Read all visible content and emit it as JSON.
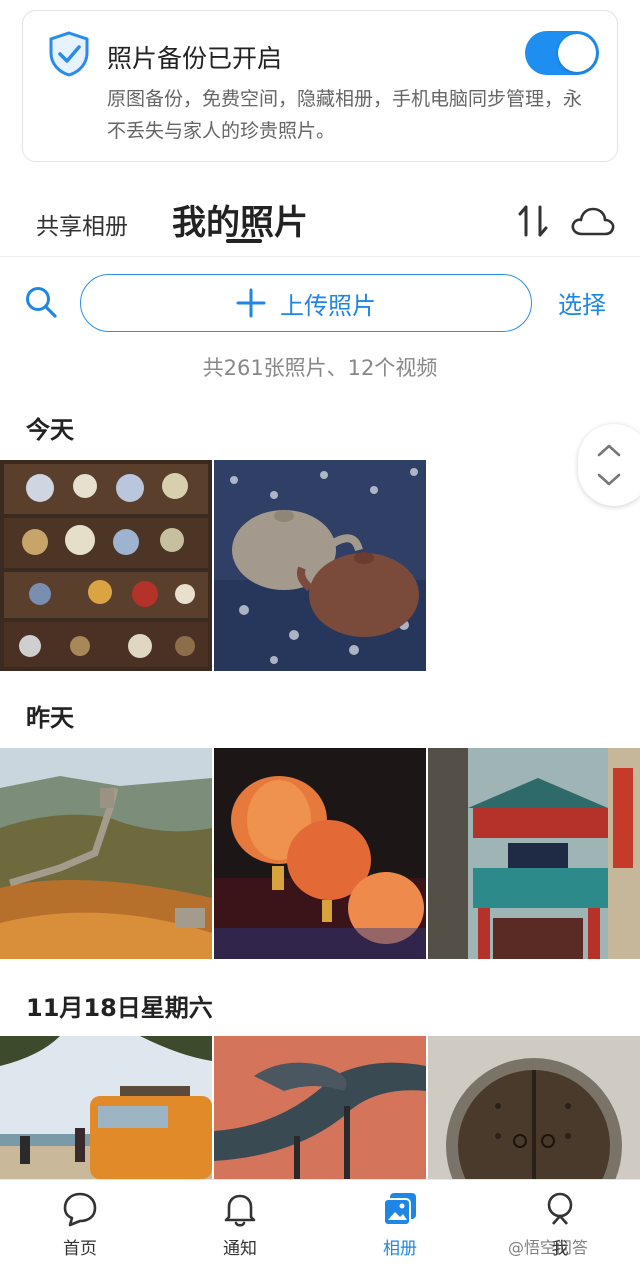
{
  "banner": {
    "title": "照片备份已开启",
    "description": "原图备份，免费空间，隐藏相册，手机电脑同步管理，永不丢失与家人的珍贵照片。",
    "toggle_on": true,
    "accent": "#1e8ef0"
  },
  "tabs": {
    "shared": "共享相册",
    "mine": "我的照片",
    "active": "mine"
  },
  "toolbar": {
    "upload_label": "上传照片",
    "select_label": "选择"
  },
  "summary": "共261张照片、12个视频",
  "sections": [
    {
      "title": "今天",
      "photos": [
        {
          "subject": "antique-shelves"
        },
        {
          "subject": "teapots"
        }
      ]
    },
    {
      "title": "昨天",
      "photos": [
        {
          "subject": "great-wall"
        },
        {
          "subject": "red-lanterns"
        },
        {
          "subject": "chinatown-gate"
        }
      ]
    },
    {
      "title": "11月18日星期六",
      "photos": [
        {
          "subject": "orange-van-beach"
        },
        {
          "subject": "dragon-roof"
        },
        {
          "subject": "round-wooden-door"
        }
      ]
    }
  ],
  "bottom_nav": [
    {
      "label": "首页",
      "icon": "chat-bubble-icon"
    },
    {
      "label": "通知",
      "icon": "bell-icon"
    },
    {
      "label": "相册",
      "icon": "album-icon",
      "active": true
    },
    {
      "label": "我",
      "icon": "person-icon"
    }
  ],
  "watermark": "@悟空问答"
}
